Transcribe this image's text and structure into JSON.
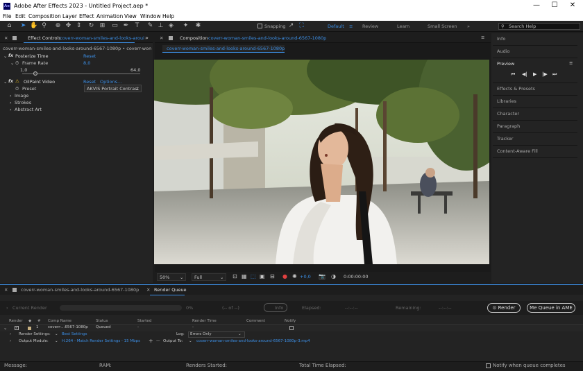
{
  "app": {
    "title": "Adobe After Effects 2023 - Untitled Project.aep *",
    "logo": "Ae"
  },
  "window_controls": {
    "minimize": "—",
    "maximize": "☐",
    "close": "✕"
  },
  "menu": [
    "File",
    "Edit",
    "Composition",
    "Layer",
    "Effect",
    "Animation",
    "View",
    "Window",
    "Help"
  ],
  "toolbar": {
    "snapping_label": "Snapping",
    "workspaces": [
      "Default",
      "Review",
      "Learn",
      "Small Screen"
    ],
    "search_placeholder": "Search Help"
  },
  "effect_controls": {
    "tab_label": "Effect Controls",
    "tab_layer": "coverr-woman-smiles-and-looks-aroui",
    "path": "coverr-woman-smiles-and-looks-around-6567-1080p • coverr-woman-sm",
    "posterize": {
      "name": "Posterize Time",
      "reset": "Reset",
      "frame_rate_label": "Frame Rate",
      "frame_rate_value": "8,0",
      "min": "1,0",
      "max": "64,0",
      "slider_fraction": 0.11
    },
    "oilpaint": {
      "name": "OilPaint Video",
      "reset": "Reset",
      "options": "Options...",
      "preset_label": "Preset",
      "preset_value": "AKVIS Portrait Contrast",
      "groups": [
        "Image",
        "Strokes",
        "Abstract Art"
      ]
    }
  },
  "composition": {
    "tab_label": "Composition",
    "tab_name": "coverr-woman-smiles-and-looks-around-6567-1080p",
    "sub_tab": "coverr-woman-smiles-and-looks-around-6567-1080p",
    "zoom": "50%",
    "resolution": "Full",
    "exposure": "+0,0",
    "timecode": "0:00:00:00"
  },
  "right_panels": [
    "Info",
    "Audio",
    "Preview",
    "Effects & Presets",
    "Libraries",
    "Character",
    "Paragraph",
    "Tracker",
    "Content-Aware Fill"
  ],
  "bottom_tabs": {
    "timeline": "coverr-woman-smiles-and-looks-around-6567-1080p",
    "render_queue": "Render Queue"
  },
  "render_progress": {
    "label": "Current Render",
    "percent": "0%",
    "of": "(-- of --)",
    "info": "Info",
    "elapsed_label": "Elapsed:",
    "elapsed_value": "--:--:--",
    "remaining_label": "Remaining:",
    "remaining_value": "--:--:--"
  },
  "render_buttons": {
    "render": "Render",
    "ame": "Queue in AME"
  },
  "queue_headers": [
    "Render",
    "#",
    "Comp Name",
    "Status",
    "Started",
    "Render Time",
    "Comment",
    "Notify"
  ],
  "queue_item": {
    "num": "1",
    "comp": "coverr-...6567-1080p",
    "status": "Queued",
    "started": "-",
    "render_time": "-"
  },
  "render_settings": {
    "label": "Render Settings:",
    "value": "Best Settings",
    "log_label": "Log:",
    "log_value": "Errors Only"
  },
  "output_module": {
    "label": "Output Module:",
    "value": "H.264 - Match Render Settings - 15 Mbps",
    "output_to_label": "Output To:",
    "output_to_value": "coverr-woman-smiles-and-looks-around-6567-1080p-3.mp4"
  },
  "status_bar": {
    "message": "Message:",
    "ram": "RAM:",
    "renders_started": "Renders Started:",
    "total_time": "Total Time Elapsed:",
    "notify": "Notify when queue completes"
  }
}
